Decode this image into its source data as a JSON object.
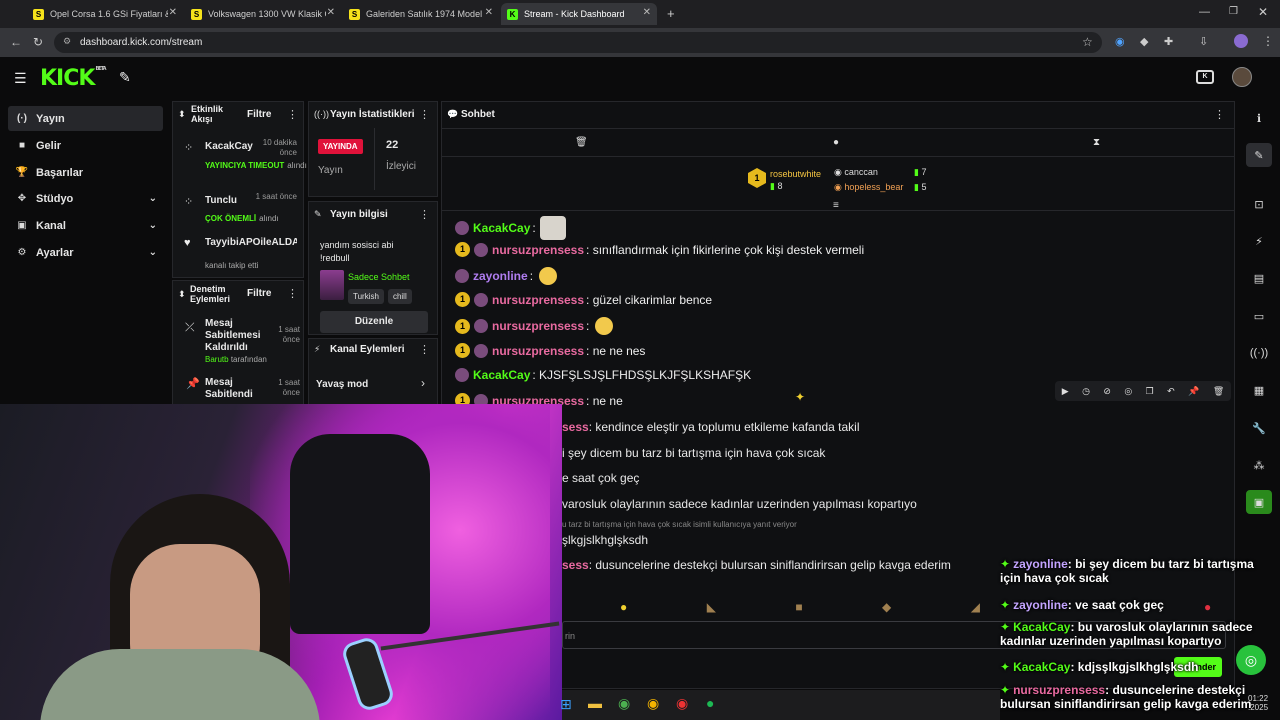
{
  "browser": {
    "tabs": [
      {
        "label": "Opel Corsa 1.6 GSi Fiyatları & M",
        "fav": "S",
        "color": "#f6e31b"
      },
      {
        "label": "Volkswagen 1300 VW Klasik Ot",
        "fav": "S",
        "color": "#f6e31b"
      },
      {
        "label": "Galeriden Satılık 1974 Model K",
        "fav": "S",
        "color": "#f6e31b"
      },
      {
        "label": "Stream - Kick Dashboard",
        "fav": "K",
        "color": "#53fc18"
      }
    ],
    "url": "dashboard.kick.com/stream"
  },
  "kick": {
    "logo": "KICK",
    "beta": "BETA"
  },
  "nav": [
    {
      "label": "Yayın",
      "icon": "broadcast-icon",
      "sym": "(·)",
      "selected": true,
      "chevron": false
    },
    {
      "label": "Gelir",
      "icon": "money-icon",
      "sym": "■",
      "selected": false,
      "chevron": false
    },
    {
      "label": "Başarılar",
      "icon": "trophy-icon",
      "sym": "🏆",
      "selected": false,
      "chevron": false
    },
    {
      "label": "Stüdyo",
      "icon": "studio-icon",
      "sym": "✥",
      "selected": false,
      "chevron": true
    },
    {
      "label": "Kanal",
      "icon": "channel-icon",
      "sym": "▣",
      "selected": false,
      "chevron": true
    },
    {
      "label": "Ayarlar",
      "icon": "gear-icon",
      "sym": "⚙",
      "selected": false,
      "chevron": true
    }
  ],
  "activity": {
    "title": "Etkinlik Akışı",
    "filter": "Filtre",
    "items": [
      {
        "user": "KacakCay",
        "time": "10 dakika önce",
        "status": "YAYINCIYA TIMEOUT",
        "detail": "alındı"
      },
      {
        "user": "Tunclu",
        "time": "1 saat önce",
        "status": "ÇOK ÖNEMLİ",
        "detail": "alındı"
      },
      {
        "user": "TayyibiAPOileALDATI",
        "time": "",
        "status": "",
        "detail": "kanalı takip etti"
      }
    ]
  },
  "moderation": {
    "title": "Denetim Eylemleri",
    "filter": "Filtre",
    "items": [
      {
        "line1": "Mesaj",
        "line2": "Sabitlemesi",
        "line3": "Kaldırıldı",
        "time": "1 saat önce",
        "by": "Barutb",
        "by_suffix": "tarafından"
      },
      {
        "line1": "Mesaj",
        "line2": "Sabitlendi",
        "time": "1 saat önce"
      }
    ]
  },
  "stats": {
    "title": "Yayın İstatistikleri",
    "live": "YAYINDA",
    "live_label": "Yayın",
    "viewers": "22",
    "viewers_label": "İzleyici"
  },
  "info": {
    "title": "Yayın bilgisi",
    "stream_title": "yandım sosisci abi !redbull",
    "category": "Sadece Sohbet",
    "tags": [
      "Turkish",
      "chill"
    ],
    "edit": "Düzenle"
  },
  "channel_actions": {
    "title": "Kanal Eylemleri",
    "slow": "Yavaş mod"
  },
  "chat": {
    "title": "Sohbet",
    "top": [
      {
        "name": "rosebutwhite",
        "count": "8"
      },
      {
        "name": "canccan",
        "count": "7"
      },
      {
        "name": "hopeless_bear",
        "count": "5"
      }
    ],
    "messages": [
      {
        "badge": false,
        "user": "KacakCay",
        "color": "#53fc18",
        "text": ":",
        "emote": "cat"
      },
      {
        "badge": true,
        "user": "nursuzprensess",
        "color": "#e86aa0",
        "text": ": sınıflandırmak için fikirlerine çok kişi destek vermeli"
      },
      {
        "badge": false,
        "user": "zayonline",
        "color": "#b07df0",
        "text": ":",
        "emote": "yellow"
      },
      {
        "badge": true,
        "user": "nursuzprensess",
        "color": "#e86aa0",
        "text": ": güzel cikarimlar bence"
      },
      {
        "badge": true,
        "user": "nursuzprensess",
        "color": "#e86aa0",
        "text": ":",
        "emote": "yellow"
      },
      {
        "badge": true,
        "user": "nursuzprensess",
        "color": "#e86aa0",
        "text": ": ne ne nes"
      },
      {
        "badge": false,
        "user": "KacakCay",
        "color": "#53fc18",
        "text": ": KJSFŞLSJŞLFHDSŞLKJFŞLKSHAFŞK"
      },
      {
        "badge": true,
        "user": "nursuzprensess",
        "color": "#e86aa0",
        "text": ": ne ne"
      }
    ],
    "partial": [
      {
        "a": "sess",
        "b": ": kendince eleştir ya toplumu etkileme kafanda takil"
      },
      {
        "a": "",
        "b": "i şey dicem bu tarz bi tartışma için hava çok sıcak"
      },
      {
        "a": "",
        "b": "e saat çok geç"
      },
      {
        "a": "",
        "b": "varosluk olaylarının sadece kadınlar uzerinden yapılması kopartıyo"
      }
    ],
    "reply_note": "u tarz bi tartışma için hava çok sıcak isimli kullanıcıya yanıt veriyor",
    "reply_text": "şlkgjslkhglşksdh",
    "last_a": "sess",
    "last_b": ": dusuncelerine destekçi bulursan siniflandirirsan gelip kavga ederim",
    "input_placeholder": "rin",
    "send": "nder"
  },
  "overlay": [
    {
      "user": "zayonline",
      "color": "#c3a4ff",
      "text": ": bi şey dicem bu tarz bi tartışma",
      "text2": "için hava çok sıcak"
    },
    {
      "user": "zayonline",
      "color": "#c3a4ff",
      "text": ": ve saat çok geç",
      "text2": ""
    },
    {
      "user": "KacakCay",
      "color": "#53fc18",
      "text": ": bu varosluk olaylarının sadece",
      "text2": "kadınlar uzerinden yapılması kopartıyo"
    },
    {
      "user": "KacakCay",
      "color": "#53fc18",
      "text": ": kdjsşlkgjslkhglşksdh",
      "text2": ""
    },
    {
      "user": "nursuzprensess",
      "color": "#e86aa0",
      "text": ": dusuncelerine destekçi",
      "text2": "bulursan siniflandirirsan gelip kavga ederim"
    }
  ],
  "clock": {
    "time": "01:22",
    "date": ".2025"
  }
}
